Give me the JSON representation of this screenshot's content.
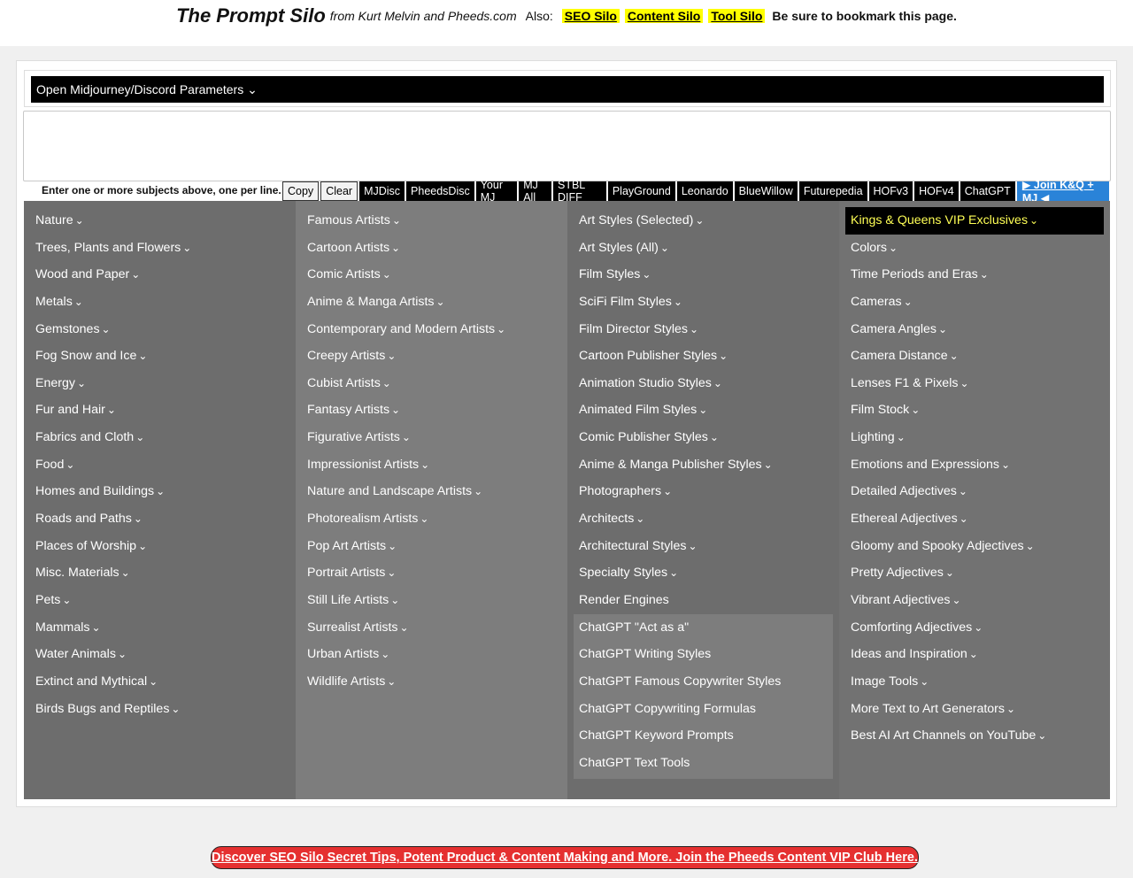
{
  "header": {
    "title": "The Prompt Silo",
    "byline": "from Kurt Melvin and Pheeds.com",
    "also": "Also:",
    "links": [
      "SEO Silo",
      "Content Silo",
      "Tool Silo"
    ],
    "bookmark": "Be sure to bookmark this page."
  },
  "params": {
    "label": "Open Midjourney/Discord Parameters ⌄"
  },
  "subject": {
    "value": ""
  },
  "toolbar": {
    "instruction": "Enter one or more subjects above, one per line.",
    "copy": "Copy",
    "clear": "Clear",
    "buttons": [
      "MJDisc",
      "PheedsDisc",
      "Your MJ",
      "MJ All",
      "STBL DIFF",
      "PlayGround",
      "Leonardo",
      "BlueWillow",
      "Futurepedia",
      "HOFv3",
      "HOFv4",
      "ChatGPT"
    ],
    "join": "▶ Join K&Q + MJ ◀"
  },
  "columns": {
    "col1": [
      "Nature",
      "Trees, Plants and Flowers",
      "Wood and Paper",
      "Metals",
      "Gemstones",
      "Fog Snow and Ice",
      "Energy",
      "Fur and Hair",
      "Fabrics and Cloth",
      "Food",
      "Homes and Buildings",
      "Roads and Paths",
      "Places of Worship",
      "Misc. Materials",
      "Pets",
      "Mammals",
      "Water Animals",
      "Extinct and Mythical",
      "Birds Bugs and Reptiles"
    ],
    "col2": [
      "Famous Artists",
      "Cartoon Artists",
      "Comic Artists",
      "Anime & Manga Artists",
      "Contemporary and Modern Artists",
      "Creepy Artists",
      "Cubist Artists",
      "Fantasy Artists",
      "Figurative Artists",
      "Impressionist Artists",
      "Nature and Landscape Artists",
      "Photorealism Artists",
      "Pop Art Artists",
      "Portrait Artists",
      "Still Life Artists",
      "Surrealist Artists",
      "Urban Artists",
      "Wildlife Artists"
    ],
    "col3": [
      "Art Styles (Selected)",
      "Art Styles (All)",
      "Film Styles",
      "SciFi Film Styles",
      "Film Director Styles",
      "Cartoon Publisher Styles",
      "Animation Studio Styles",
      "Animated Film Styles",
      "Comic Publisher Styles",
      "Anime & Manga Publisher Styles",
      "Photographers",
      "Architects",
      "Architectural Styles",
      "Specialty Styles",
      "Render Engines"
    ],
    "col3_gpt": [
      "ChatGPT \"Act as a\"",
      "ChatGPT Writing Styles",
      "ChatGPT Famous Copywriter Styles",
      "ChatGPT Copywriting Formulas",
      "ChatGPT Keyword Prompts",
      "ChatGPT Text Tools"
    ],
    "col4_vip": "Kings & Queens VIP Exclusives",
    "col4": [
      "Colors",
      "Time Periods and Eras",
      "Cameras",
      "Camera Angles",
      "Camera Distance",
      "Lenses F1 & Pixels",
      "Film Stock",
      "Lighting",
      "Emotions and Expressions",
      "Detailed Adjectives",
      "Ethereal Adjectives",
      "Gloomy and Spooky Adjectives",
      "Pretty Adjectives",
      "Vibrant Adjectives",
      "Comforting Adjectives",
      "Ideas and Inspiration",
      "Image Tools",
      "More Text to Art Generators",
      "Best AI Art Channels on YouTube"
    ]
  },
  "chevron": "⌄",
  "banner": "Discover SEO Silo Secret Tips, Potent Product & Content Making and More. Join the Pheeds Content VIP Club Here."
}
